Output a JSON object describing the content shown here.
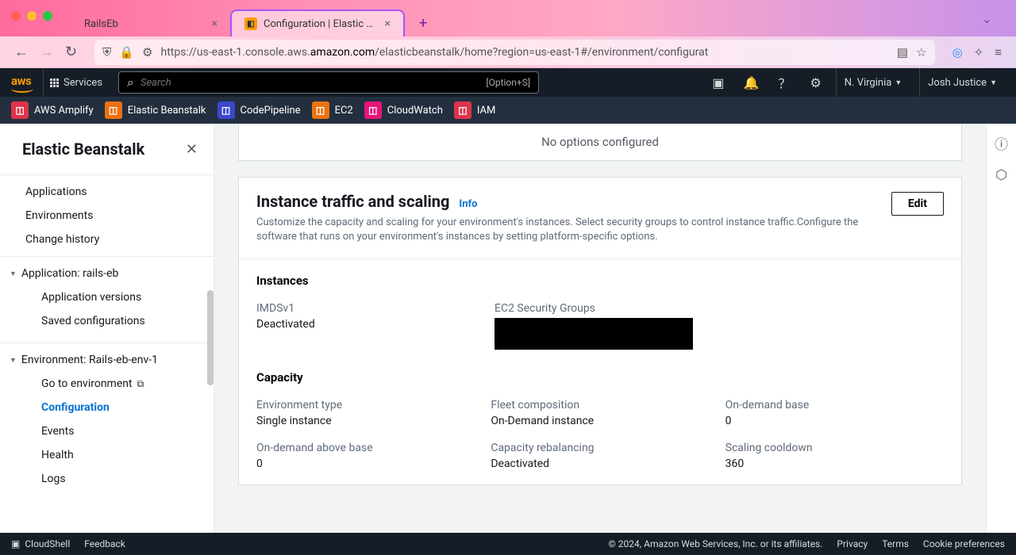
{
  "browser": {
    "tabs": [
      {
        "title": "RailsEb",
        "active": false
      },
      {
        "title": "Configuration | Elastic Beanstalk",
        "active": true
      }
    ],
    "url_prefix": "https://us-east-1.console.aws.",
    "url_domain": "amazon.com",
    "url_suffix": "/elasticbeanstalk/home?region=us-east-1#/environment/configurat"
  },
  "aws_header": {
    "services": "Services",
    "search_placeholder": "Search",
    "kbd": "[Option+S]",
    "region": "N. Virginia",
    "user": "Josh Justice"
  },
  "service_bar": [
    {
      "icon_class": "svc-amplify",
      "label": "AWS Amplify"
    },
    {
      "icon_class": "svc-eb",
      "label": "Elastic Beanstalk"
    },
    {
      "icon_class": "svc-cp",
      "label": "CodePipeline"
    },
    {
      "icon_class": "svc-ec2",
      "label": "EC2"
    },
    {
      "icon_class": "svc-cw",
      "label": "CloudWatch"
    },
    {
      "icon_class": "svc-iam",
      "label": "IAM"
    }
  ],
  "sidebar": {
    "title": "Elastic Beanstalk",
    "top_links": [
      "Applications",
      "Environments",
      "Change history"
    ],
    "app_section": "Application: rails-eb",
    "app_children": [
      "Application versions",
      "Saved configurations"
    ],
    "env_section": "Environment: Rails-eb-env-1",
    "env_children": [
      {
        "label": "Go to environment",
        "ext": true,
        "active": false
      },
      {
        "label": "Configuration",
        "ext": false,
        "active": true
      },
      {
        "label": "Events",
        "ext": false,
        "active": false
      },
      {
        "label": "Health",
        "ext": false,
        "active": false
      },
      {
        "label": "Logs",
        "ext": false,
        "active": false
      }
    ]
  },
  "main": {
    "no_options": "No options configured",
    "card": {
      "title": "Instance traffic and scaling",
      "info": "Info",
      "desc": "Customize the capacity and scaling for your environment's instances. Select security groups to control instance traffic.Configure the software that runs on your environment's instances by setting platform-specific options.",
      "edit": "Edit",
      "instances_heading": "Instances",
      "instances": [
        {
          "label": "IMDSv1",
          "value": "Deactivated"
        },
        {
          "label": "EC2 Security Groups",
          "value": "",
          "redacted": true
        }
      ],
      "capacity_heading": "Capacity",
      "capacity": [
        {
          "label": "Environment type",
          "value": "Single instance"
        },
        {
          "label": "Fleet composition",
          "value": "On-Demand instance"
        },
        {
          "label": "On-demand base",
          "value": "0"
        },
        {
          "label": "On-demand above base",
          "value": "0"
        },
        {
          "label": "Capacity rebalancing",
          "value": "Deactivated"
        },
        {
          "label": "Scaling cooldown",
          "value": "360"
        }
      ]
    }
  },
  "footer": {
    "cloudshell": "CloudShell",
    "feedback": "Feedback",
    "copyright": "© 2024, Amazon Web Services, Inc. or its affiliates.",
    "links": [
      "Privacy",
      "Terms",
      "Cookie preferences"
    ]
  }
}
